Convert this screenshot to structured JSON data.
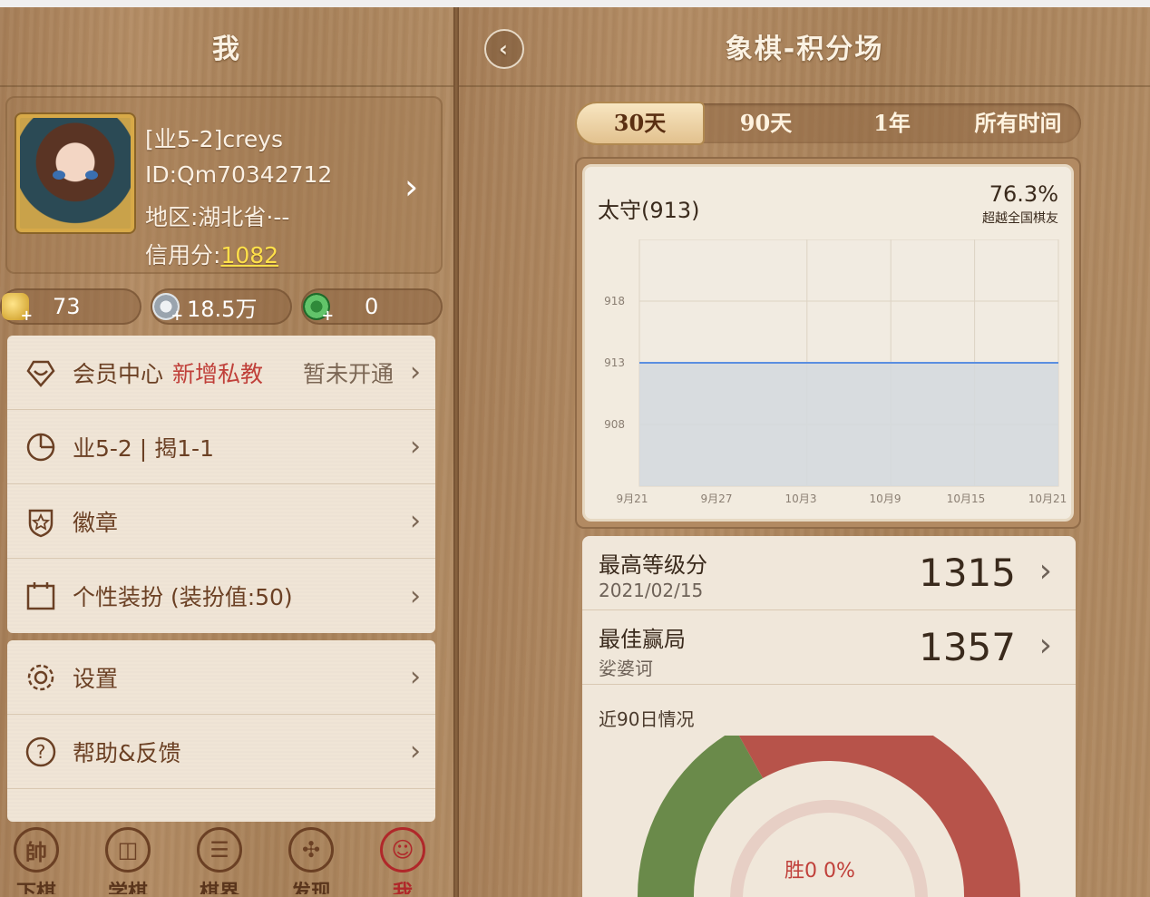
{
  "left": {
    "header_title": "我",
    "profile": {
      "name": "[业5-2]creys",
      "id": "ID:Qm70342712",
      "region": "地区:湖北省·--",
      "credit_label": "信用分:",
      "credit_value": "1082"
    },
    "currencies": [
      {
        "icon": "gold-ingot-icon",
        "value": "73"
      },
      {
        "icon": "silver-coin-icon",
        "value": "18.5万"
      },
      {
        "icon": "green-token-icon",
        "value": "0"
      }
    ],
    "menu_group1": [
      {
        "icon": "vip-heart-icon",
        "label": "会员中心",
        "extra": "新增私教",
        "right": "暂未开通"
      },
      {
        "icon": "pie-chart-icon",
        "label": "业5-2 | 揭1-1",
        "extra": "",
        "right": ""
      },
      {
        "icon": "badge-shield-icon",
        "label": "徽章",
        "extra": "",
        "right": ""
      },
      {
        "icon": "calendar-icon",
        "label": "个性装扮 (装扮值:50)",
        "extra": "",
        "right": ""
      }
    ],
    "menu_group2": [
      {
        "icon": "gear-icon",
        "label": "设置"
      },
      {
        "icon": "help-icon",
        "label": "帮助&反馈"
      }
    ],
    "nav": [
      {
        "icon": "shuai-icon",
        "glyph": "帥",
        "label": "下棋"
      },
      {
        "icon": "learn-icon",
        "glyph": "◫",
        "label": "学棋"
      },
      {
        "icon": "chat-icon",
        "glyph": "☰",
        "label": "棋界"
      },
      {
        "icon": "compass-icon",
        "glyph": "✣",
        "label": "发现"
      },
      {
        "icon": "profile-icon",
        "glyph": "☺",
        "label": "我"
      }
    ],
    "colors": {
      "menu_text": "#6b4024",
      "accent_red": "#c0403a",
      "credit_yellow": "#ffe04a"
    }
  },
  "right": {
    "header_title": "象棋-积分场",
    "tabs": [
      "30天",
      "90天",
      "1年",
      "所有时间"
    ],
    "active_tab": "30天",
    "rating_label": "太守(913)",
    "percentile": "76.3%",
    "percentile_caption": "超越全国棋友",
    "chart_data": {
      "type": "area",
      "title": "",
      "x": [
        "9月21",
        "9月27",
        "10月3",
        "10月9",
        "10月15",
        "10月21"
      ],
      "y_ticks": [
        908,
        913,
        918
      ],
      "ylim": [
        903,
        923
      ],
      "series": [
        {
          "name": "",
          "values": [
            913,
            913,
            913,
            913,
            913,
            913
          ]
        }
      ],
      "grid": true,
      "line_color": "#5b8fe0",
      "fill_color": "#d3d9de"
    },
    "stats": [
      {
        "label": "最高等级分",
        "sub": "2021/02/15",
        "value": "1315"
      },
      {
        "label": "最佳赢局",
        "sub": "娑婆诃",
        "value": "1357"
      }
    ],
    "recent_label": "近90日情况",
    "donut_text": "胜0  0%",
    "colors": {
      "win_green": "#6a8a4a",
      "loss_red": "#b7534a"
    }
  }
}
